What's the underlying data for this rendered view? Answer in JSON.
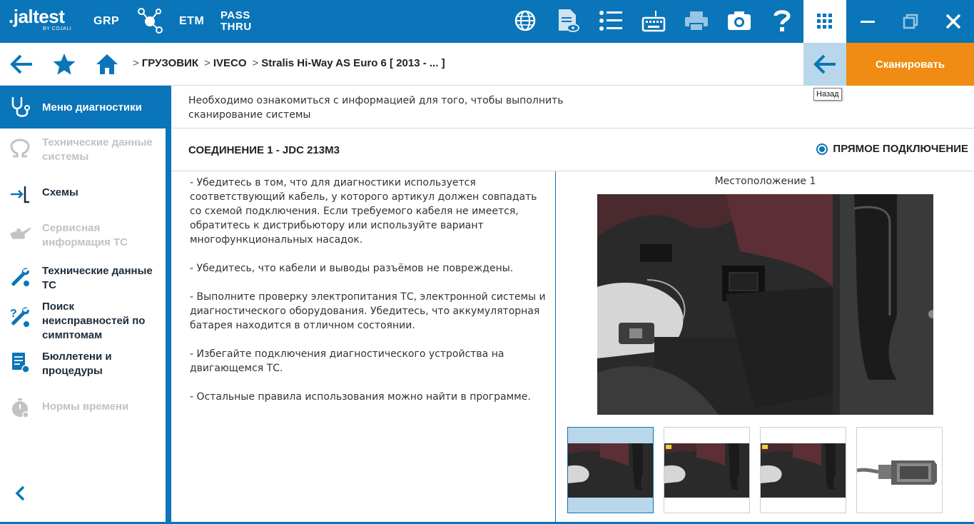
{
  "topbar": {
    "logo_text": ".jaltest",
    "logo_sub": "BY COJALI",
    "grp": "GRP",
    "etm": "ETM",
    "pass_thru_line1": "PASS",
    "pass_thru_line2": "THRU"
  },
  "navbar": {
    "breadcrumbs": [
      "ГРУЗОВИК",
      "IVECO",
      "Stralis Hi-Way AS Euro 6 [ 2013 - ... ]"
    ],
    "crumb_separator": ">",
    "scan_label": "Сканировать",
    "back_tooltip": "Назад"
  },
  "sidebar": {
    "active_label": "Меню диагностики",
    "items": [
      {
        "label": "Технические данные системы",
        "enabled": false,
        "icon": "omega-icon"
      },
      {
        "label": "Схемы",
        "enabled": true,
        "icon": "schematics-icon"
      },
      {
        "label": "Сервисная информация ТС",
        "enabled": false,
        "icon": "oil-can-icon"
      },
      {
        "label": "Технические данные ТС",
        "enabled": true,
        "icon": "wrench-icon"
      },
      {
        "label": "Поиск неисправностей по симптомам",
        "enabled": true,
        "icon": "wrench-question-icon"
      },
      {
        "label": "Бюллетени и процедуры",
        "enabled": true,
        "icon": "bulletin-icon"
      },
      {
        "label": "Нормы времени",
        "enabled": false,
        "icon": "stopwatch-icon"
      }
    ]
  },
  "main": {
    "info_text": "Необходимо ознакомиться с информацией для того, чтобы выполнить сканирование системы",
    "connection_title": "СОЕДИНЕНИЕ 1 - JDC 213M3",
    "connection_option": "ПРЯМОЕ ПОДКЛЮЧЕНИЕ",
    "instructions": [
      "- Убедитесь в том, что для диагностики используется соответствующий кабель, у которого артикул должен совпадать со схемой подключения. Если требуемого кабеля не имеется, обратитесь к дистрибьютору или используйте вариант многофункциональных насадок.",
      "- Убедитесь, что кабели и выводы разъёмов не повреждены.",
      "- Выполните проверку электропитания ТС, электронной системы и диагностического оборудования. Убедитесь, что аккумуляторная батарея находится в отличном состоянии.",
      "- Избегайте подключения диагностического устройства на двигающемся ТС.",
      "- Остальные правила использования можно найти в программе."
    ],
    "location_title": "Местоположение 1",
    "thumbnails": [
      {
        "name": "location-1",
        "selected": true
      },
      {
        "name": "location-2",
        "selected": false
      },
      {
        "name": "location-3",
        "selected": false
      },
      {
        "name": "obd-connector",
        "selected": false
      }
    ]
  },
  "colors": {
    "brand_blue": "#0a75b8",
    "scan_orange": "#f08c13",
    "highlight": "#b9d7ea"
  }
}
